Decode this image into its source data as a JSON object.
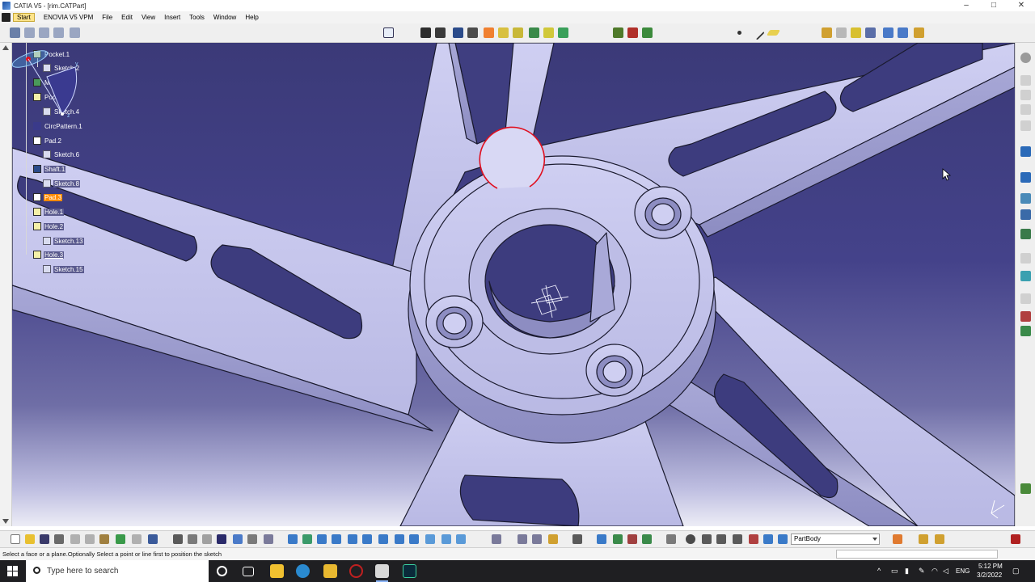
{
  "window": {
    "title": "CATIA V5 - [rim.CATPart]",
    "controls": [
      "–",
      "□",
      "✕"
    ]
  },
  "menu": [
    "Start",
    "ENOVIA V5 VPM",
    "File",
    "Edit",
    "View",
    "Insert",
    "Tools",
    "Window",
    "Help"
  ],
  "tree": [
    {
      "label": "Pocket.1",
      "kind": "feature",
      "level": 1,
      "state": "normal"
    },
    {
      "label": "Sketch.2",
      "kind": "sketch",
      "level": 2,
      "state": "normal"
    },
    {
      "label": "Mirror.1",
      "kind": "feature",
      "level": 1,
      "state": "normal"
    },
    {
      "label": "Pocket.4",
      "kind": "feature",
      "level": 1,
      "state": "normal"
    },
    {
      "label": "Sketch.4",
      "kind": "sketch",
      "level": 2,
      "state": "normal"
    },
    {
      "label": "CircPattern.1",
      "kind": "feature",
      "level": 1,
      "state": "normal"
    },
    {
      "label": "Pad.2",
      "kind": "pad",
      "level": 1,
      "state": "normal"
    },
    {
      "label": "Sketch.6",
      "kind": "sketch",
      "level": 2,
      "state": "normal"
    },
    {
      "label": "Shaft.1",
      "kind": "feature",
      "level": 1,
      "state": "selected"
    },
    {
      "label": "Sketch.8",
      "kind": "sketch",
      "level": 2,
      "state": "selected"
    },
    {
      "label": "Pad.3",
      "kind": "pad",
      "level": 1,
      "state": "active"
    },
    {
      "label": "Hole.1",
      "kind": "feature",
      "level": 1,
      "state": "selected"
    },
    {
      "label": "Hole.2",
      "kind": "feature",
      "level": 1,
      "state": "selected"
    },
    {
      "label": "Sketch.13",
      "kind": "sketch",
      "level": 2,
      "state": "selected"
    },
    {
      "label": "Hole.3",
      "kind": "feature",
      "level": 1,
      "state": "selected"
    },
    {
      "label": "Sketch.15",
      "kind": "sketch",
      "level": 2,
      "state": "selected"
    }
  ],
  "compass": {
    "axes": [
      "x",
      "y",
      "z"
    ]
  },
  "bottom_toolbar": {
    "body_select": "PartBody"
  },
  "status": {
    "message": "Select a face or a plane.Optionally Select a point or line first to position the sketch"
  },
  "taskbar": {
    "search_placeholder": "Type here to search",
    "language": "ENG",
    "time": "5:12 PM",
    "date": "3/2/2022"
  },
  "colors": {
    "background_top": "#3b3a78",
    "background_bottom": "#ececf6",
    "part_face": "#c9c9ee",
    "part_edge": "#1a1a2e",
    "highlight": "#e01020",
    "active_feature": "#ff8a00"
  }
}
